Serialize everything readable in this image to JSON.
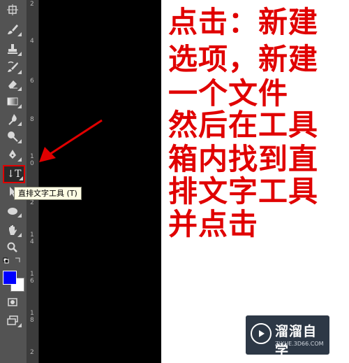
{
  "toolbar": {
    "tools": [
      {
        "name": "artboard-tool",
        "icon": "artboard-icon"
      },
      {
        "name": "brush-tool",
        "icon": "brush-icon"
      },
      {
        "name": "clone-stamp-tool",
        "icon": "stamp-icon"
      },
      {
        "name": "history-brush-tool",
        "icon": "history-brush-icon"
      },
      {
        "name": "eraser-tool",
        "icon": "eraser-icon"
      },
      {
        "name": "gradient-tool",
        "icon": "gradient-icon"
      },
      {
        "name": "blur-tool",
        "icon": "blur-drop-icon"
      },
      {
        "name": "dodge-tool",
        "icon": "dodge-icon"
      },
      {
        "name": "pen-tool",
        "icon": "pen-icon"
      },
      {
        "name": "vertical-type-tool",
        "icon": "vertical-type-icon",
        "label": "↓T"
      },
      {
        "name": "path-selection-tool",
        "icon": "path-selection-icon"
      },
      {
        "name": "ellipse-tool",
        "icon": "ellipse-icon"
      },
      {
        "name": "hand-tool",
        "icon": "hand-icon"
      },
      {
        "name": "zoom-tool",
        "icon": "zoom-icon"
      },
      {
        "name": "quick-mask-tool",
        "icon": "quick-mask-icon"
      },
      {
        "name": "screen-mode-tool",
        "icon": "screen-mode-icon"
      }
    ],
    "foreground_color": "#0000ff",
    "background_color": "#ffffff"
  },
  "tooltip": "直排文字工具 (T)",
  "ruler": {
    "labels": [
      "2",
      "4",
      "6",
      "8",
      "1",
      "0",
      "1",
      "2",
      "1",
      "4",
      "1",
      "6",
      "1",
      "8",
      "2"
    ]
  },
  "instruction": {
    "color": "#e00000",
    "lines": [
      "点击：新建",
      "选项，新建",
      "一个文件",
      "然后在工具",
      "箱内找到直",
      "排文字工具",
      "并点击"
    ]
  },
  "watermark": {
    "title": "溜溜自学",
    "url": "ZIXUE.3D66.COM"
  },
  "annotation_arrow_color": "#e00000"
}
